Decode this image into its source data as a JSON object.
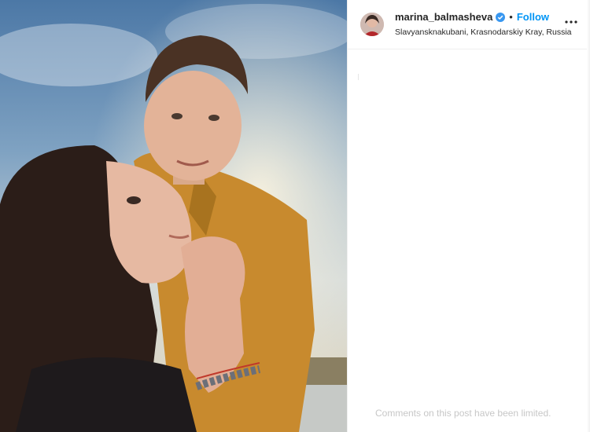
{
  "post": {
    "photo_alt": "post-photo"
  },
  "header": {
    "username": "marina_balmasheva",
    "separator": "•",
    "follow_label": "Follow",
    "location": "Slavyansknakubani, Krasnodarskiy Kray, Russia"
  },
  "comments": {
    "note": "Comments on this post have been limited."
  },
  "colors": {
    "follow": "#0095f6",
    "verified": "#3897f0",
    "text": "#262626"
  },
  "icons": {
    "verified": "verified-badge-icon",
    "more": "more-options-icon"
  }
}
